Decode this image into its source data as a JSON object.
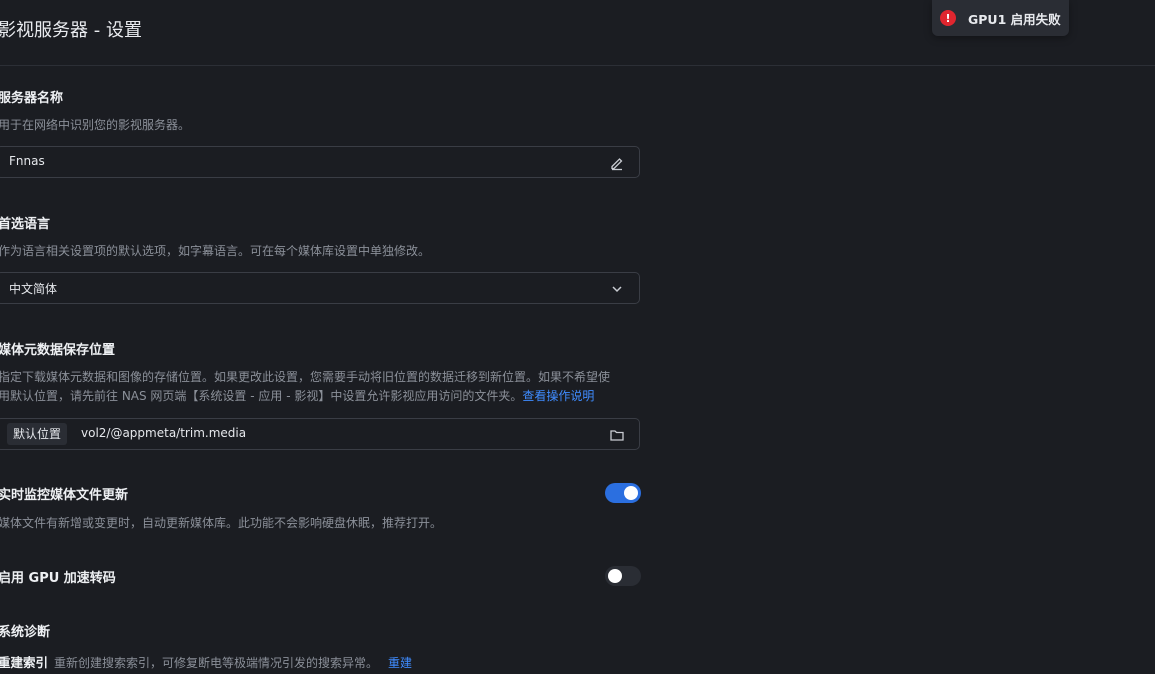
{
  "header": {
    "title": "影视服务器 - 设置"
  },
  "toast": {
    "text": "GPU1 启用失败",
    "icon": "error-icon",
    "color": "#e0262f"
  },
  "server_name": {
    "title": "服务器名称",
    "description": "用于在网络中识别您的影视服务器。",
    "value": "Fnnas",
    "icon": "edit-icon"
  },
  "language": {
    "title": "首选语言",
    "description": "作为语言相关设置项的默认选项，如字幕语言。可在每个媒体库设置中单独修改。",
    "value": "中文简体",
    "icon": "chevron-down-icon"
  },
  "metadata": {
    "title": "媒体元数据保存位置",
    "description_line1": "指定下载媒体元数据和图像的存储位置。如果更改此设置，您需要手动将旧位置的数据迁移到新位置。如果不希望使",
    "description_line2": "用默认位置，请先前往 NAS 网页端【系统设置 - 应用 - 影视】中设置允许影视应用访问的文件夹。",
    "link": "查看操作说明",
    "tag": "默认位置",
    "path": "vol2/@appmeta/trim.media",
    "icon": "folder-icon"
  },
  "monitor": {
    "title": "实时监控媒体文件更新",
    "description": "媒体文件有新增或变更时，自动更新媒体库。此功能不会影响硬盘休眠，推荐打开。",
    "enabled": true
  },
  "gpu": {
    "title": "启用 GPU 加速转码",
    "enabled": false
  },
  "diagnostics": {
    "title": "系统诊断",
    "rebuild_label": "重建索引",
    "rebuild_text": "重新创建搜索索引，可修复断电等极端情况引发的搜索异常。",
    "rebuild_link": "重建"
  },
  "colors": {
    "accent": "#2b6fe0",
    "link": "#3f8cff",
    "background": "#1b1d22"
  }
}
